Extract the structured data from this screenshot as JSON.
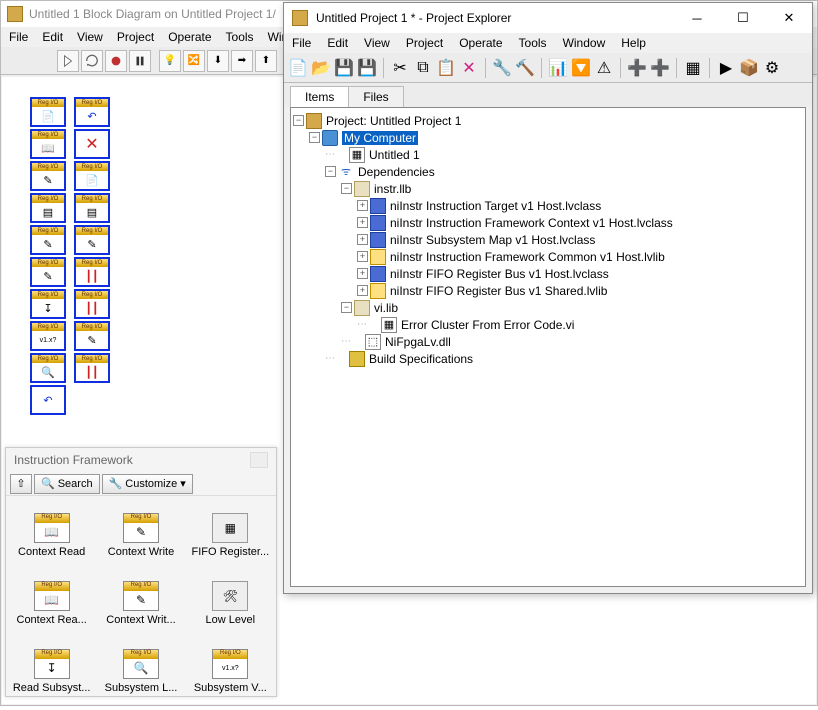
{
  "block_diagram": {
    "title": "Untitled 1 Block Diagram on Untitled Project 1/",
    "menu": [
      "File",
      "Edit",
      "View",
      "Project",
      "Operate",
      "Tools",
      "Win"
    ],
    "font_size": "15"
  },
  "palette": {
    "title": "Instruction Framework",
    "search_label": "Search",
    "customize_label": "Customize",
    "items": [
      {
        "label": "Context Read",
        "badge": "Reg I/O",
        "glyph": "📖"
      },
      {
        "label": "Context Write",
        "badge": "Reg I/O",
        "glyph": "✎"
      },
      {
        "label": "FIFO Register...",
        "badge": "",
        "glyph": "▦",
        "right": true
      },
      {
        "label": "Context Rea...",
        "badge": "Reg I/O",
        "glyph": "📖"
      },
      {
        "label": "Context Writ...",
        "badge": "Reg I/O",
        "glyph": "✎"
      },
      {
        "label": "Low Level",
        "badge": "",
        "glyph": "🛠",
        "right": true
      },
      {
        "label": "Read Subsyst...",
        "badge": "Reg I/O",
        "glyph": "↧"
      },
      {
        "label": "Subsystem L...",
        "badge": "Reg I/O",
        "glyph": "🔍"
      },
      {
        "label": "Subsystem V...",
        "badge": "Reg I/O",
        "glyph": "v1.x?"
      }
    ]
  },
  "project_explorer": {
    "title": "Untitled Project 1 * - Project Explorer",
    "menu": [
      "File",
      "Edit",
      "View",
      "Project",
      "Operate",
      "Tools",
      "Window",
      "Help"
    ],
    "tabs": [
      "Items",
      "Files"
    ],
    "active_tab": 0,
    "tree": {
      "root": "Project: Untitled Project 1",
      "my_computer": "My Computer",
      "untitled_vi": "Untitled 1",
      "dependencies": "Dependencies",
      "instr_llb": "instr.llb",
      "instr_items": [
        "niInstr Instruction Target v1 Host.lvclass",
        "niInstr Instruction Framework Context v1 Host.lvclass",
        "niInstr Subsystem Map v1 Host.lvclass",
        "niInstr Instruction Framework Common v1 Host.lvlib",
        "niInstr FIFO Register Bus v1 Host.lvclass",
        "niInstr FIFO Register Bus v1 Shared.lvlib"
      ],
      "vi_lib": "vi.lib",
      "vi_items": [
        "Error Cluster From Error Code.vi"
      ],
      "dll": "NiFpgaLv.dll",
      "build_specs": "Build Specifications"
    }
  },
  "canvas_palette": {
    "col1": [
      {
        "g": "📄"
      },
      {
        "g": "📖"
      },
      {
        "g": "✎"
      },
      {
        "g": "▤"
      },
      {
        "g": "✎"
      },
      {
        "g": "✎"
      },
      {
        "g": "↧"
      },
      {
        "g": "v1.x?"
      },
      {
        "g": "🔍"
      },
      {
        "g": "↶"
      }
    ],
    "col2": [
      {
        "g": "↶"
      },
      {
        "g": "✕",
        "red": true
      },
      {
        "g": "📄"
      },
      {
        "g": "▤"
      },
      {
        "g": "✎"
      },
      {
        "g": "┃┃"
      },
      {
        "g": "┃┃"
      },
      {
        "g": "✎"
      },
      {
        "g": "┃┃"
      }
    ]
  }
}
